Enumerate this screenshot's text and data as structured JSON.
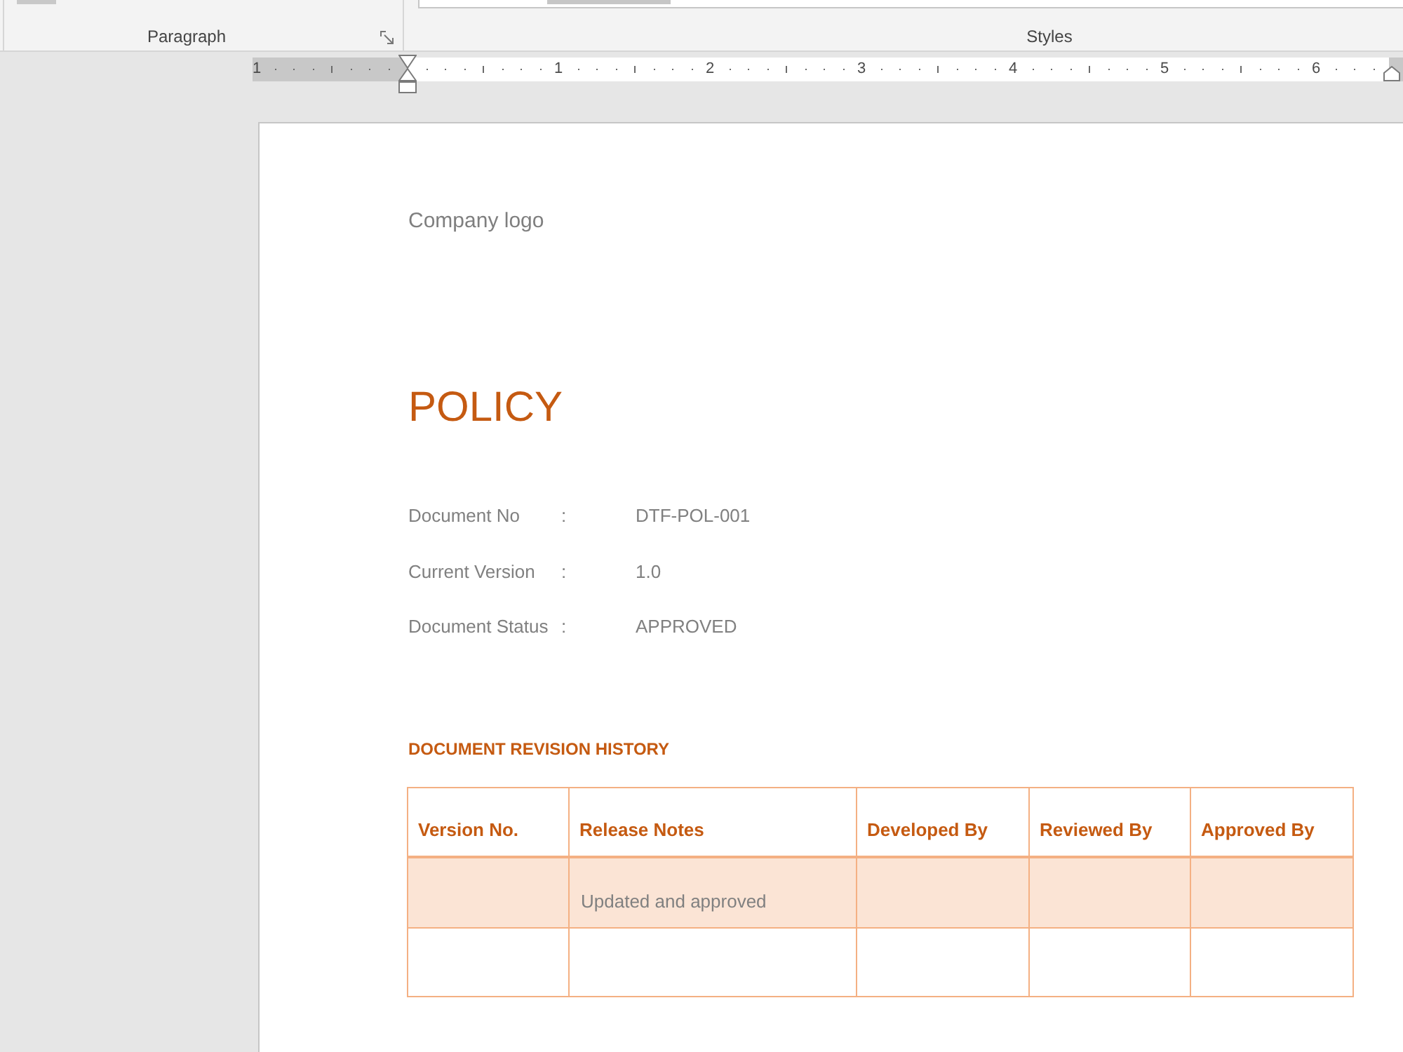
{
  "ribbon": {
    "paragraph_group": {
      "label": "Paragraph"
    },
    "styles_group": {
      "label": "Styles"
    }
  },
  "ruler": {
    "numbers": [
      "1",
      "1",
      "2",
      "3",
      "4",
      "5",
      "6"
    ]
  },
  "document": {
    "logo_placeholder": "Company logo",
    "title": "POLICY",
    "fields": [
      {
        "label": "Document No",
        "separator": ":",
        "value": "DTF-POL-001"
      },
      {
        "label": "Current Version",
        "separator": ":",
        "value": "1.0"
      },
      {
        "label": "Document Status",
        "separator": ":",
        "value": "APPROVED"
      }
    ],
    "section_heading": "DOCUMENT REVISION HISTORY",
    "revision_table": {
      "columns": [
        "Version No.",
        "Release Notes",
        "Developed By",
        "Reviewed By",
        "Approved By"
      ],
      "rows": [
        {
          "shaded": true,
          "release_notes": "Updated and approved"
        },
        {
          "shaded": false
        }
      ]
    }
  }
}
